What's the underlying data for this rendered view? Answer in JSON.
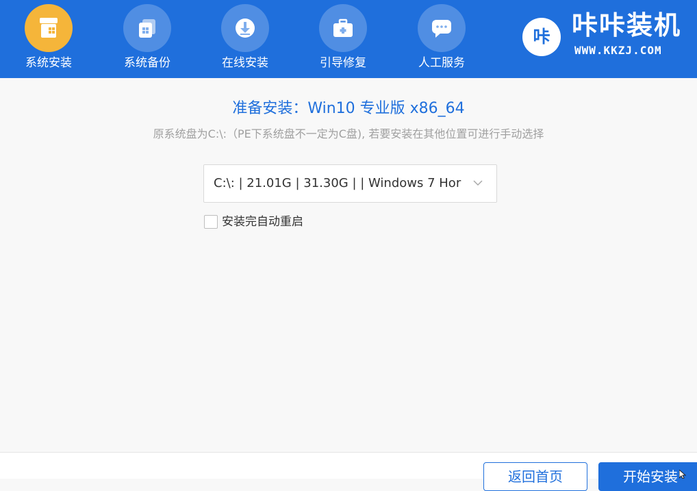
{
  "nav": {
    "items": [
      {
        "label": "系统安装",
        "icon": "windows-package-icon",
        "active": true
      },
      {
        "label": "系统备份",
        "icon": "backup-copy-icon",
        "active": false
      },
      {
        "label": "在线安装",
        "icon": "download-icon",
        "active": false
      },
      {
        "label": "引导修复",
        "icon": "toolbox-icon",
        "active": false
      },
      {
        "label": "人工服务",
        "icon": "chat-bubble-icon",
        "active": false
      }
    ]
  },
  "brand": {
    "logo_text": "咔",
    "name": "咔咔装机",
    "url": "WWW.KKZJ.COM"
  },
  "main": {
    "title": "准备安装：Win10 专业版 x86_64",
    "subtitle": "原系统盘为C:\\:（PE下系统盘不一定为C盘), 若要安装在其他位置可进行手动选择",
    "partition_select": {
      "value": "C:\\: | 21.01G | 31.30G |  | Windows 7 Hor"
    },
    "auto_restart": {
      "label": "安装完自动重启",
      "checked": false
    }
  },
  "footer": {
    "back_label": "返回首页",
    "start_label": "开始安装"
  },
  "colors": {
    "brand_blue": "#1f6fdc",
    "active_orange": "#f5b53a",
    "subtitle_gray": "#a0a0a0"
  }
}
